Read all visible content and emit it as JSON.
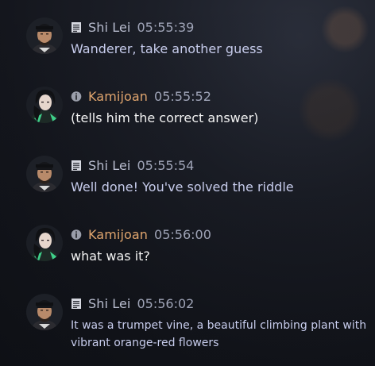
{
  "messages": [
    {
      "speaker": "Shi Lei",
      "time": "05:55:39",
      "text": "Wanderer, take another guess",
      "kind": "npc",
      "icon": "scroll-icon"
    },
    {
      "speaker": "Kamijoan",
      "time": "05:55:52",
      "text": "(tells him the correct answer)",
      "kind": "player",
      "icon": "info-icon"
    },
    {
      "speaker": "Shi Lei",
      "time": "05:55:54",
      "text": "Well done! You've solved the riddle",
      "kind": "npc",
      "icon": "scroll-icon"
    },
    {
      "speaker": "Kamijoan",
      "time": "05:56:00",
      "text": "what was it?",
      "kind": "player",
      "icon": "info-icon"
    },
    {
      "speaker": "Shi Lei",
      "time": "05:56:02",
      "text": "It was a trumpet vine, a beautiful climbing plant with vibrant orange-red flowers",
      "kind": "npc",
      "icon": "scroll-icon"
    }
  ],
  "colors": {
    "npc_name": "#b9bdcf",
    "player_name": "#e0a56e",
    "npc_text": "#c7ccec",
    "player_text": "#f2f2f2",
    "timestamp": "#9fa4b7"
  }
}
